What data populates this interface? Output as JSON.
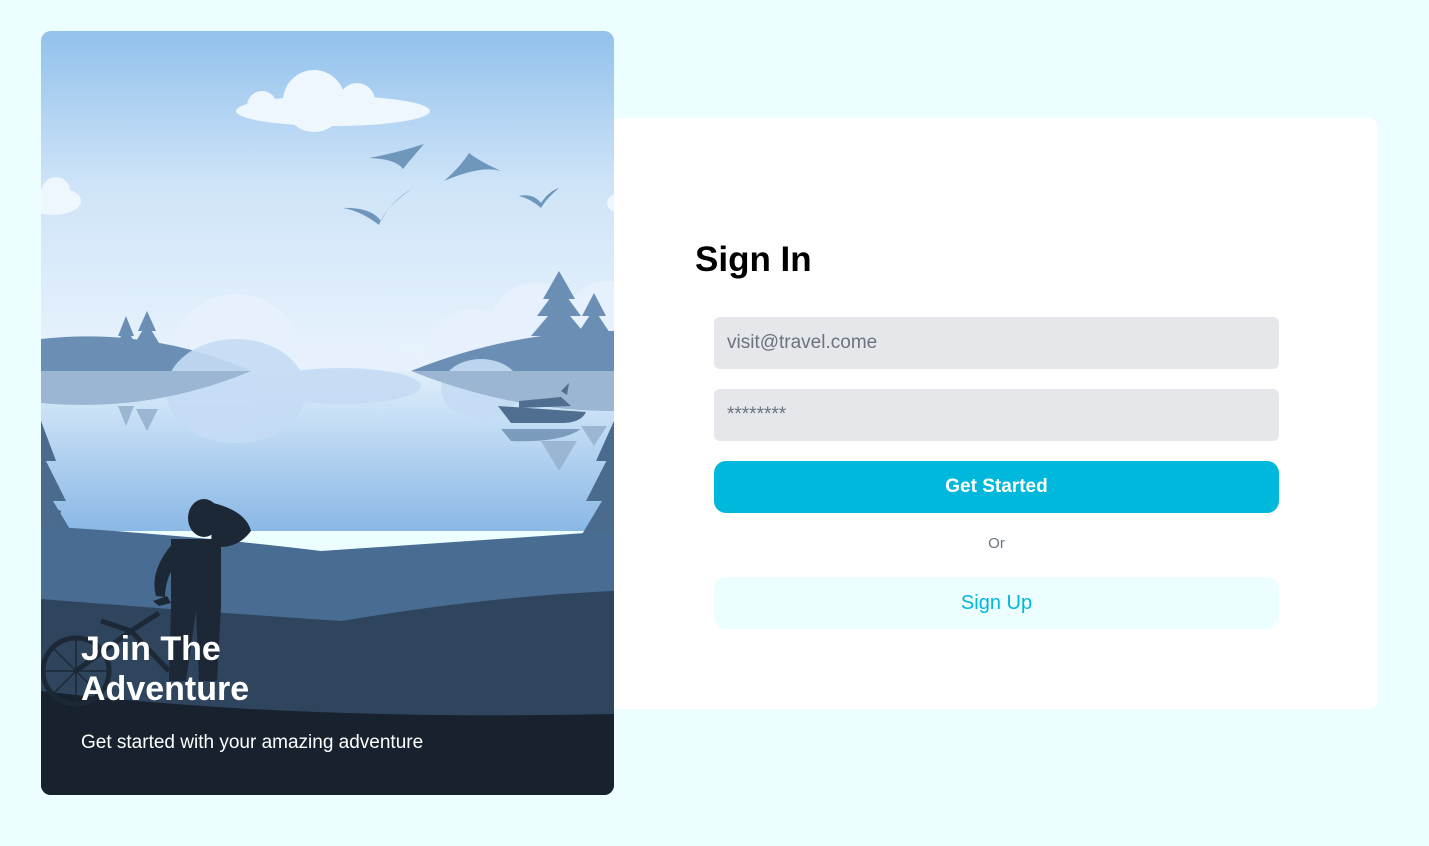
{
  "hero": {
    "title": "Join The Adventure",
    "subtitle": "Get started with your amazing adventure"
  },
  "signin": {
    "title": "Sign In",
    "email_placeholder": "visit@travel.come",
    "password_placeholder": "********",
    "submit_label": "Get Started",
    "divider_text": "Or",
    "signup_label": "Sign Up"
  },
  "colors": {
    "page_background": "#ecfeff",
    "card_background": "#ffffff",
    "input_background": "#e5e7eb",
    "primary_button": "#00b8db",
    "secondary_button_background": "#ecfeff",
    "secondary_button_text": "#00b8db"
  }
}
